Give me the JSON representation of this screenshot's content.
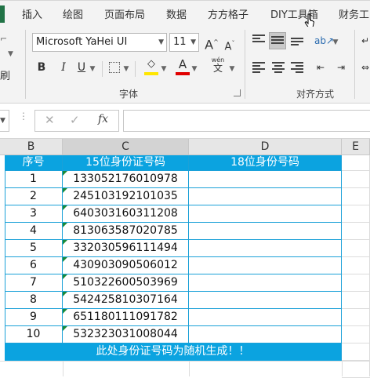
{
  "ribbon": {
    "tabs": [
      "插入",
      "绘图",
      "页面布局",
      "数据",
      "方方格子",
      "DIY工具箱",
      "财务工"
    ],
    "left_fragments": [
      "刷"
    ],
    "font": {
      "name": "Microsoft YaHei UI",
      "size": "11",
      "grow_label": "A",
      "shrink_label": "A",
      "bold": "B",
      "italic": "I",
      "underline": "U",
      "phonetic_label": "wén",
      "group_label": "字体"
    },
    "alignment": {
      "group_label": "对齐方式"
    },
    "colors": {
      "highlight": "#ffe600",
      "font_color": "#e00000",
      "accent": "#217346"
    }
  },
  "formula_bar": {
    "cancel": "✕",
    "enter": "✓",
    "fx": "fx",
    "value": ""
  },
  "sheet": {
    "columns": [
      "B",
      "C",
      "D",
      "E"
    ],
    "headers": [
      "序号",
      "15位身份证号码",
      "18位身份号码"
    ],
    "rows": [
      {
        "n": "1",
        "id15": "133052176010978",
        "id18": ""
      },
      {
        "n": "2",
        "id15": "245103192101035",
        "id18": ""
      },
      {
        "n": "3",
        "id15": "640303160311208",
        "id18": ""
      },
      {
        "n": "4",
        "id15": "813063587020785",
        "id18": ""
      },
      {
        "n": "5",
        "id15": "332030596111494",
        "id18": ""
      },
      {
        "n": "6",
        "id15": "430903090506012",
        "id18": ""
      },
      {
        "n": "7",
        "id15": "510322600503969",
        "id18": ""
      },
      {
        "n": "8",
        "id15": "542425810307164",
        "id18": ""
      },
      {
        "n": "9",
        "id15": "651180111091782",
        "id18": ""
      },
      {
        "n": "10",
        "id15": "532323031008044",
        "id18": ""
      }
    ],
    "note": "此处身份证号码为随机生成！！",
    "header_color": "#0ba3e0"
  }
}
